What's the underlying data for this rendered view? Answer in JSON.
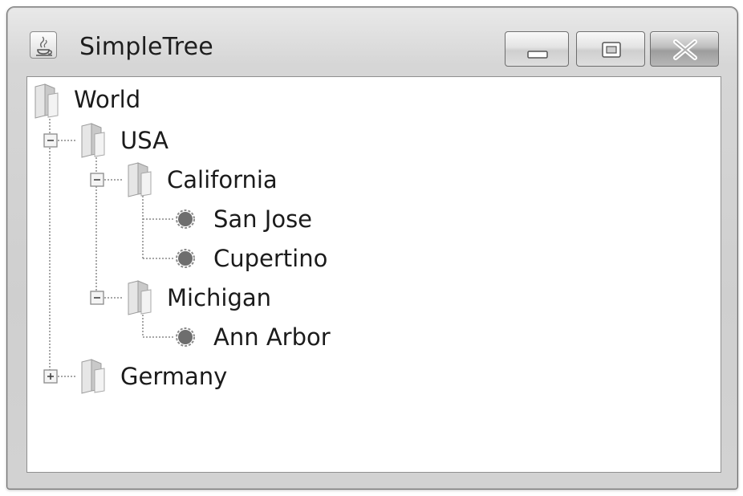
{
  "window": {
    "title": "SimpleTree",
    "app_icon": "java-cup-icon",
    "controls": {
      "minimize": "minimize-icon",
      "maximize": "maximize-icon",
      "close": "close-icon"
    }
  },
  "tree": {
    "nodes": [
      {
        "id": "world",
        "label": "World",
        "type": "folder",
        "expanded": true
      },
      {
        "id": "usa",
        "label": "USA",
        "type": "folder",
        "expanded": true
      },
      {
        "id": "california",
        "label": "California",
        "type": "folder",
        "expanded": true
      },
      {
        "id": "san-jose",
        "label": "San Jose",
        "type": "leaf"
      },
      {
        "id": "cupertino",
        "label": "Cupertino",
        "type": "leaf"
      },
      {
        "id": "michigan",
        "label": "Michigan",
        "type": "folder",
        "expanded": true
      },
      {
        "id": "ann-arbor",
        "label": "Ann Arbor",
        "type": "leaf"
      },
      {
        "id": "germany",
        "label": "Germany",
        "type": "folder",
        "expanded": false
      }
    ]
  }
}
